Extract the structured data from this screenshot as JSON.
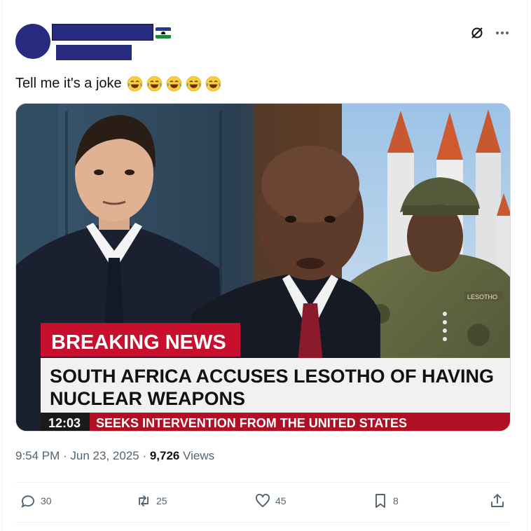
{
  "post": {
    "text": "Tell me it's a joke",
    "emoji_count": 5,
    "emoji_name": "face-with-tears-of-joy"
  },
  "media": {
    "headline_tag": "BREAKING NEWS",
    "headline_line1": "SOUTH AFRICA ACCUSES LESOTHO OF HAVING",
    "headline_line2": "NUCLEAR WEAPONS",
    "clock": "12:03",
    "ticker": "SEEKS INTERVENTION FROM THE UNITED STATES",
    "patch_text": "LESOTHO"
  },
  "meta": {
    "time": "9:54 PM",
    "sep1": " · ",
    "date": "Jun 23, 2025",
    "sep2": " · ",
    "views_count": "9,726",
    "views_label": " Views"
  },
  "actions": {
    "replies": "30",
    "reposts": "25",
    "likes": "45",
    "bookmarks": "8"
  },
  "colors": {
    "redaction": "#262b80",
    "breaking_red": "#c8102e",
    "meta_gray": "#536471"
  }
}
